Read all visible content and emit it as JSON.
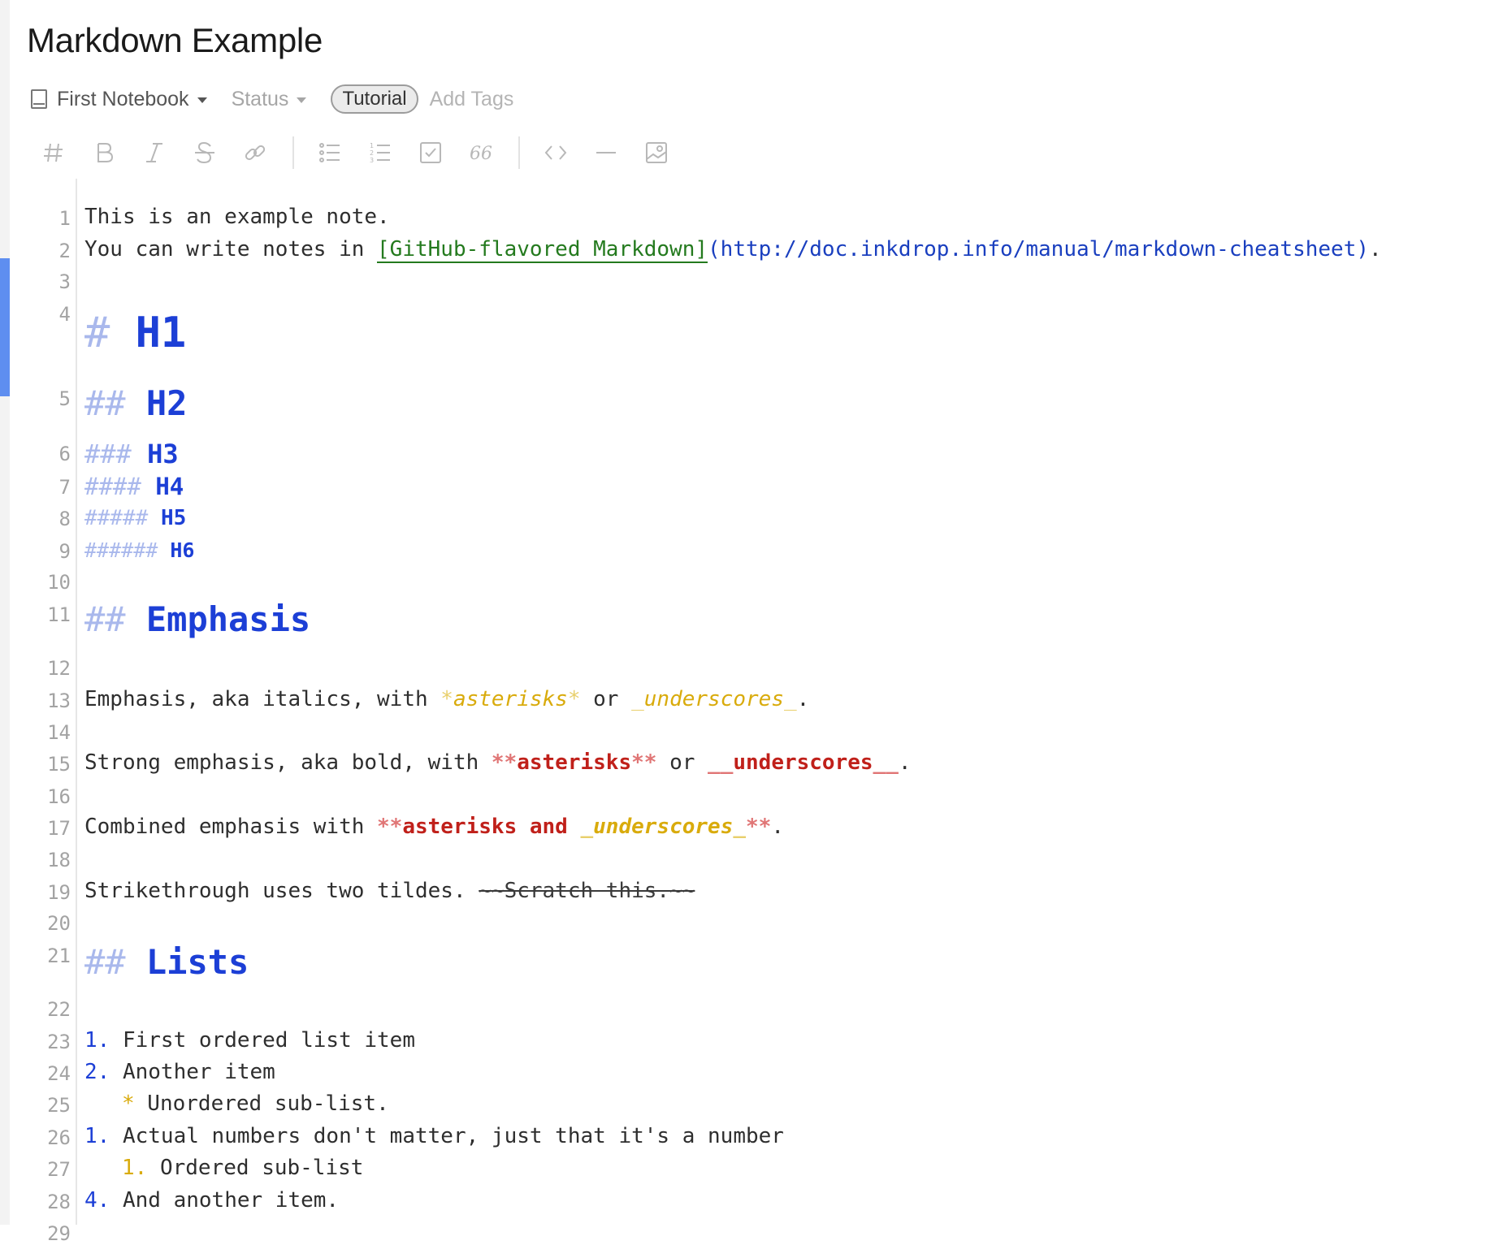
{
  "note": {
    "title": "Markdown Example"
  },
  "meta": {
    "notebook": "First Notebook",
    "status": "Status",
    "tags": [
      "Tutorial"
    ],
    "add_tags": "Add Tags"
  },
  "toolbar": {
    "icons": [
      "heading-icon",
      "bold-icon",
      "italic-icon",
      "strikethrough-icon",
      "link-icon",
      "bullet-list-icon",
      "numbered-list-icon",
      "checkbox-icon",
      "quote-icon",
      "code-icon",
      "horizontal-rule-icon",
      "image-icon"
    ],
    "quote_glyph": "66"
  },
  "gutter": [
    "1",
    "2",
    "3",
    "4",
    "5",
    "6",
    "7",
    "8",
    "9",
    "10",
    "11",
    "12",
    "13",
    "14",
    "15",
    "16",
    "17",
    "18",
    "19",
    "20",
    "21",
    "22",
    "23",
    "24",
    "25",
    "26",
    "27",
    "28",
    "29"
  ],
  "editor": {
    "line1": "This is an example note.",
    "line2": {
      "pre": "You can write notes in ",
      "link_text": "[GitHub-flavored Markdown]",
      "link_url": "(http://doc.inkdrop.info/manual/markdown-cheatsheet)",
      "post": "."
    },
    "h1": {
      "marker": "#",
      "text": "H1"
    },
    "h2": {
      "marker": "##",
      "text": "H2"
    },
    "h3": {
      "marker": "###",
      "text": "H3"
    },
    "h4": {
      "marker": "####",
      "text": "H4"
    },
    "h5": {
      "marker": "#####",
      "text": "H5"
    },
    "h6": {
      "marker": "######",
      "text": "H6"
    },
    "emphasis_heading": {
      "marker": "##",
      "text": "Emphasis"
    },
    "line13": {
      "pre": "Emphasis, aka italics, with ",
      "m1": "*",
      "t1": "asterisks",
      "m2": "*",
      "mid": " or ",
      "m3": "_",
      "t2": "underscores",
      "m4": "_",
      "post": "."
    },
    "line15": {
      "pre": "Strong emphasis, aka bold, with ",
      "m1": "**",
      "t1": "asterisks",
      "m2": "**",
      "mid": " or ",
      "m3": "__",
      "t2": "underscores",
      "m4": "__",
      "post": "."
    },
    "line17": {
      "pre": "Combined emphasis with ",
      "m1": "**",
      "t1": "asterisks and ",
      "m2": "_",
      "t2": "underscores",
      "m3": "_",
      "m4": "**",
      "post": "."
    },
    "line19": {
      "pre": "Strikethrough uses two tildes. ",
      "strike": "~~Scratch this.~~"
    },
    "lists_heading": {
      "marker": "##",
      "text": "Lists"
    },
    "list": [
      {
        "marker": "1.",
        "text": " First ordered list item"
      },
      {
        "marker": "2.",
        "text": " Another item"
      },
      {
        "marker": "*",
        "text": " Unordered sub-list."
      },
      {
        "marker": "1.",
        "text": " Actual numbers don't matter, just that it's a number"
      },
      {
        "marker": "1.",
        "text": " Ordered sub-list"
      },
      {
        "marker": "4.",
        "text": " And another item."
      }
    ]
  }
}
